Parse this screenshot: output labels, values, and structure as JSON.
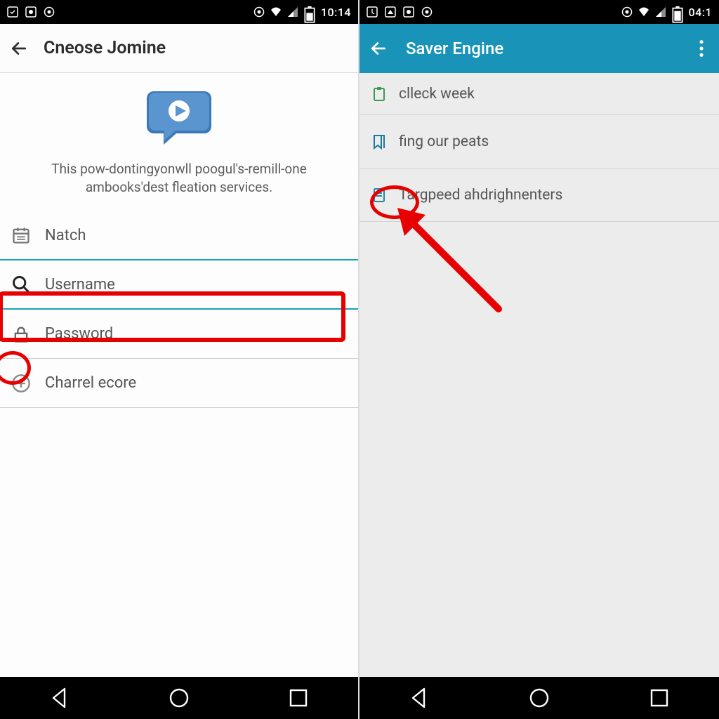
{
  "left": {
    "status": {
      "time": "10:14"
    },
    "appbar": {
      "title": "Cneose Jomine"
    },
    "hero": {
      "line1": "This pow-dontingyonwll poogul's-remill-one",
      "line2": "ambooks'dest fleation services."
    },
    "fields": {
      "natch": "Natch",
      "username": "Username",
      "password": "Password",
      "charrel": "Charrel ecore"
    }
  },
  "right": {
    "status": {
      "time": "04:1"
    },
    "appbar": {
      "title": "Saver Engine"
    },
    "rows": {
      "r1": "clleck week",
      "r2": "fing our peats",
      "r3": "Targpeed ahdrighnenters"
    }
  }
}
